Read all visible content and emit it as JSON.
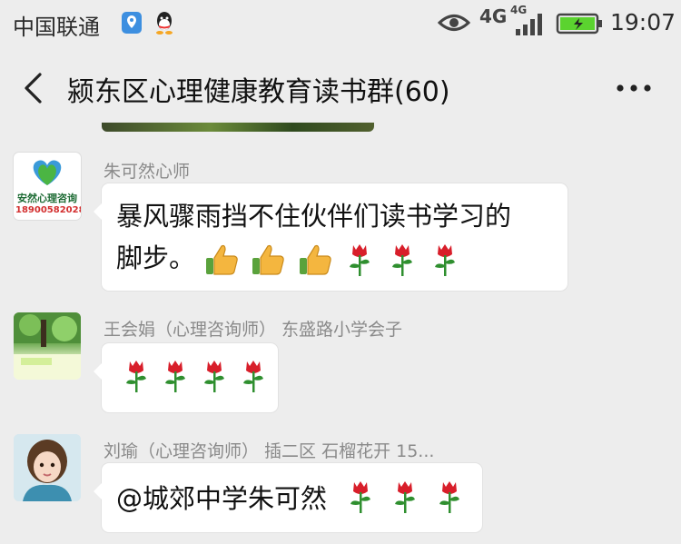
{
  "status_bar": {
    "carrier": "中国联通",
    "network": "4G",
    "network2": "4G",
    "time": "19:07",
    "icons": [
      "location-icon",
      "qq-icon",
      "eye-icon",
      "signal-icon",
      "battery-icon"
    ]
  },
  "header": {
    "title": "颍东区心理健康教育读书群(60)",
    "back_icon": "back-chevron-icon",
    "more_icon": "more-dots-icon"
  },
  "messages": [
    {
      "sender": "朱可然心师",
      "avatar": {
        "text": "安然心理咨询",
        "phone": "18900582028",
        "accent": "#2e8b3d"
      },
      "text": "暴风骤雨挡不住伙伴们读书学习的",
      "text_line2": "脚步。",
      "emojis": [
        "thumbs-up-icon",
        "thumbs-up-icon",
        "thumbs-up-icon",
        "rose-icon",
        "rose-icon",
        "rose-icon"
      ]
    },
    {
      "sender": "王会娟（心理咨询师） 东盛路小学会子",
      "emojis": [
        "rose-icon",
        "rose-icon",
        "rose-icon",
        "rose-icon"
      ]
    },
    {
      "sender": "刘瑜（心理咨询师） 插二区 石榴花开 15...",
      "text": "@城郊中学朱可然",
      "emojis": [
        "rose-icon",
        "rose-icon",
        "rose-icon"
      ]
    }
  ],
  "colors": {
    "background": "#ededed",
    "bubble": "#ffffff",
    "sender_text": "#8a8a8a",
    "rose": "#d81e2a",
    "leaf": "#2f8f2f",
    "thumb": "#f4b63f"
  }
}
